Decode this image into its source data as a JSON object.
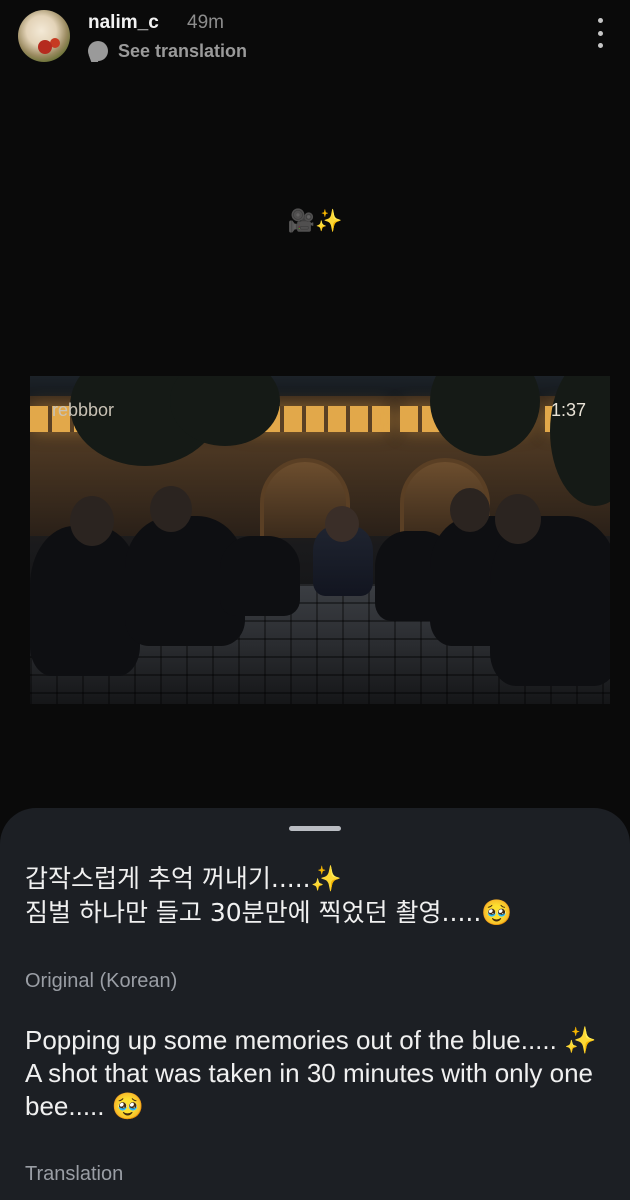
{
  "post": {
    "username": "nalim_c",
    "time": "49m",
    "see_translation": "See translation",
    "caption": "🎥✨"
  },
  "video": {
    "watermark": "rebbbor",
    "duration": "1:37"
  },
  "sheet": {
    "original_line1": "갑작스럽게 추억 꺼내기.....✨",
    "original_line2": "짐벌 하나만 들고 30분만에 찍었던 촬영.....🥹",
    "original_label": "Original (Korean)",
    "translation_line1": "Popping up some memories out of the blue..... ✨",
    "translation_line2": "A shot that was taken in 30 minutes with only one bee..... 🥹",
    "translation_label": "Translation"
  },
  "icons": {
    "avatar": "avatar",
    "translate": "translate-bubble-icon",
    "more": "more-vertical-icon"
  }
}
